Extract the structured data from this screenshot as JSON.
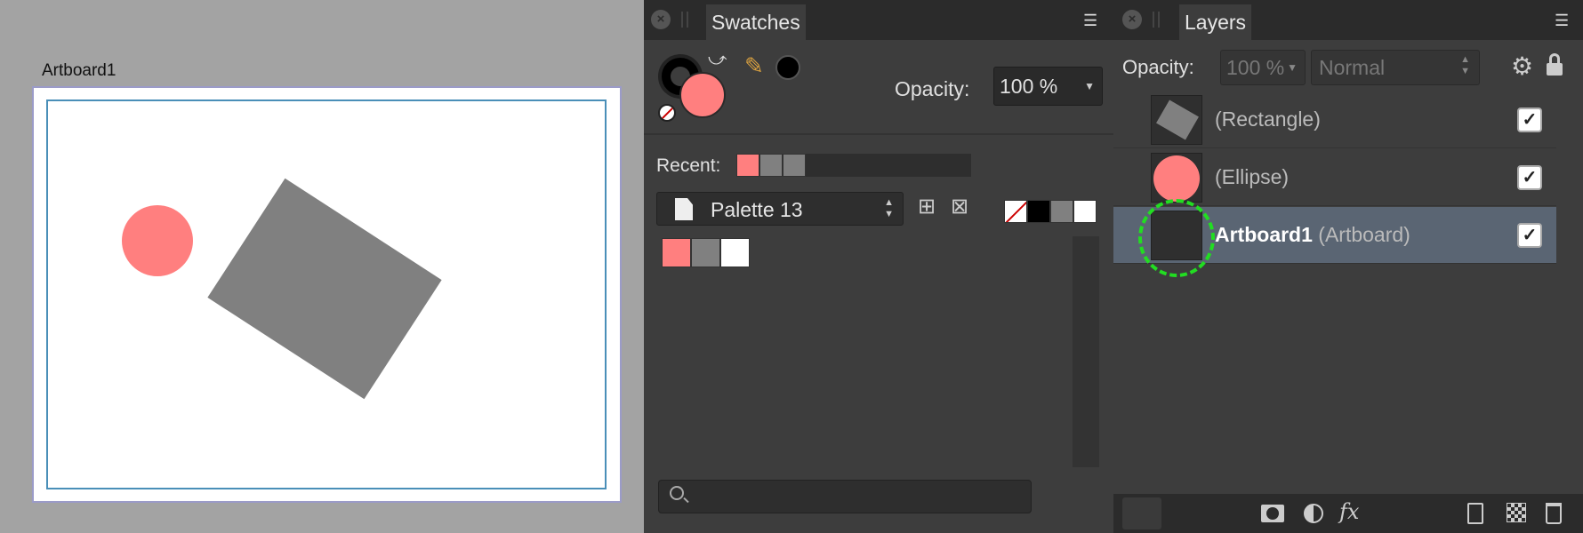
{
  "canvas": {
    "artboard_label": "Artboard1",
    "ellipse_color": "#ff7f7f",
    "rectangle_color": "#808080"
  },
  "swatches": {
    "tab_label": "Swatches",
    "menu_icon": "hamburger-menu-icon",
    "fill_color": "#ff7f7f",
    "stroke_color": "#000000",
    "opacity_label": "Opacity:",
    "opacity_value": "100 %",
    "recent_label": "Recent:",
    "recent_colors": [
      "#ff7f7f",
      "#808080",
      "#808080"
    ],
    "palette_name": "Palette 13",
    "quick_colors": [
      "#000000",
      "#808080",
      "#ffffff"
    ],
    "palette_colors": [
      "#ff7f7f",
      "#808080",
      "#ffffff"
    ],
    "search_placeholder": ""
  },
  "layers": {
    "tab_label": "Layers",
    "opacity_label": "Opacity:",
    "opacity_value": "100 %",
    "blend_mode": "Normal",
    "items": [
      {
        "name": "",
        "type": "(Rectangle)",
        "visible": true,
        "selected": false
      },
      {
        "name": "",
        "type": "(Ellipse)",
        "visible": true,
        "selected": false
      },
      {
        "name": "Artboard1",
        "type": "(Artboard)",
        "visible": true,
        "selected": true
      }
    ],
    "check_glyph": "✓"
  },
  "colors": {
    "accent_selection": "#5a6573",
    "annotation": "#22dd22"
  }
}
